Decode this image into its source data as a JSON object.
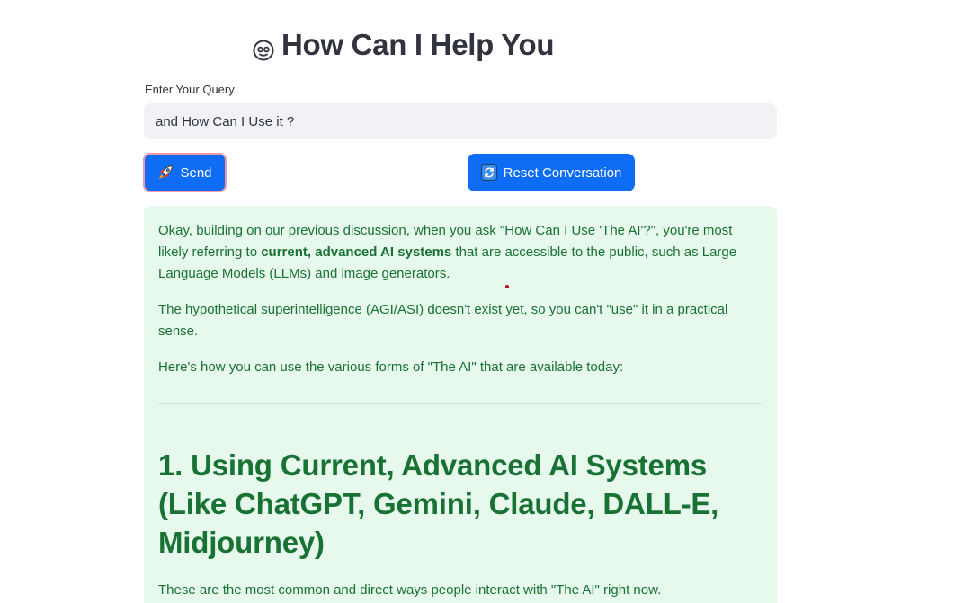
{
  "header": {
    "icon": "smiling-face-icon",
    "title": "How Can I Help You"
  },
  "query": {
    "label": "Enter Your Query",
    "value": "and How Can I Use it ?"
  },
  "buttons": {
    "send": {
      "icon": "rocket-icon",
      "label": "Send"
    },
    "reset": {
      "icon": "refresh-icon",
      "label": "Reset Conversation"
    }
  },
  "response": {
    "intro_before_bold": "Okay, building on our previous discussion, when you ask \"How Can I Use 'The AI'?\", you're most likely referring to ",
    "intro_bold": "current, advanced AI systems",
    "intro_after_bold": " that are accessible to the public, such as Large Language Models (LLMs) and image generators.",
    "paragraph2": "The hypothetical superintelligence (AGI/ASI) doesn't exist yet, so you can't \"use\" it in a practical sense.",
    "paragraph3": "Here's how you can use the various forms of \"The AI\" that are available today:",
    "heading1": "1. Using Current, Advanced AI Systems (Like ChatGPT, Gemini, Claude, DALL-E, Midjourney)",
    "paragraph4": "These are the most common and direct ways people interact with \"The AI\" right now."
  },
  "colors": {
    "primary_button": "#0f6df5",
    "response_background": "#e7f8ec",
    "response_text": "#177233",
    "input_background": "#f0f2f6"
  }
}
